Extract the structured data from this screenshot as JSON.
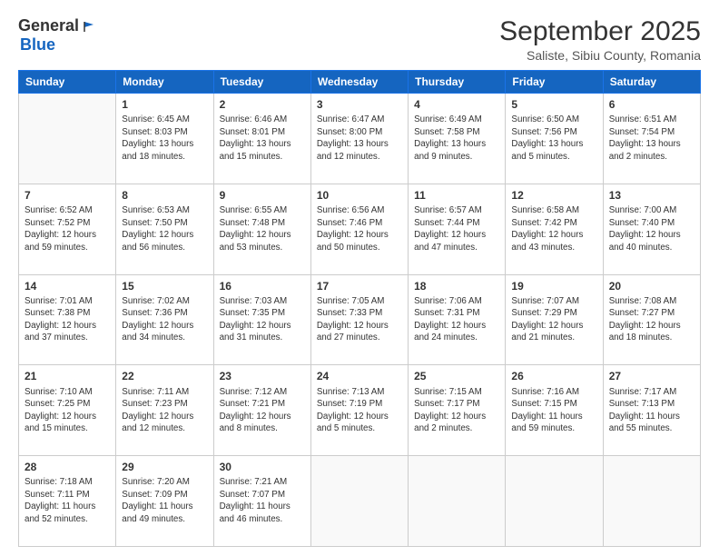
{
  "logo": {
    "general": "General",
    "blue": "Blue"
  },
  "title": "September 2025",
  "subtitle": "Saliste, Sibiu County, Romania",
  "header_days": [
    "Sunday",
    "Monday",
    "Tuesday",
    "Wednesday",
    "Thursday",
    "Friday",
    "Saturday"
  ],
  "weeks": [
    [
      {
        "day": "",
        "info": ""
      },
      {
        "day": "1",
        "info": "Sunrise: 6:45 AM\nSunset: 8:03 PM\nDaylight: 13 hours\nand 18 minutes."
      },
      {
        "day": "2",
        "info": "Sunrise: 6:46 AM\nSunset: 8:01 PM\nDaylight: 13 hours\nand 15 minutes."
      },
      {
        "day": "3",
        "info": "Sunrise: 6:47 AM\nSunset: 8:00 PM\nDaylight: 13 hours\nand 12 minutes."
      },
      {
        "day": "4",
        "info": "Sunrise: 6:49 AM\nSunset: 7:58 PM\nDaylight: 13 hours\nand 9 minutes."
      },
      {
        "day": "5",
        "info": "Sunrise: 6:50 AM\nSunset: 7:56 PM\nDaylight: 13 hours\nand 5 minutes."
      },
      {
        "day": "6",
        "info": "Sunrise: 6:51 AM\nSunset: 7:54 PM\nDaylight: 13 hours\nand 2 minutes."
      }
    ],
    [
      {
        "day": "7",
        "info": "Sunrise: 6:52 AM\nSunset: 7:52 PM\nDaylight: 12 hours\nand 59 minutes."
      },
      {
        "day": "8",
        "info": "Sunrise: 6:53 AM\nSunset: 7:50 PM\nDaylight: 12 hours\nand 56 minutes."
      },
      {
        "day": "9",
        "info": "Sunrise: 6:55 AM\nSunset: 7:48 PM\nDaylight: 12 hours\nand 53 minutes."
      },
      {
        "day": "10",
        "info": "Sunrise: 6:56 AM\nSunset: 7:46 PM\nDaylight: 12 hours\nand 50 minutes."
      },
      {
        "day": "11",
        "info": "Sunrise: 6:57 AM\nSunset: 7:44 PM\nDaylight: 12 hours\nand 47 minutes."
      },
      {
        "day": "12",
        "info": "Sunrise: 6:58 AM\nSunset: 7:42 PM\nDaylight: 12 hours\nand 43 minutes."
      },
      {
        "day": "13",
        "info": "Sunrise: 7:00 AM\nSunset: 7:40 PM\nDaylight: 12 hours\nand 40 minutes."
      }
    ],
    [
      {
        "day": "14",
        "info": "Sunrise: 7:01 AM\nSunset: 7:38 PM\nDaylight: 12 hours\nand 37 minutes."
      },
      {
        "day": "15",
        "info": "Sunrise: 7:02 AM\nSunset: 7:36 PM\nDaylight: 12 hours\nand 34 minutes."
      },
      {
        "day": "16",
        "info": "Sunrise: 7:03 AM\nSunset: 7:35 PM\nDaylight: 12 hours\nand 31 minutes."
      },
      {
        "day": "17",
        "info": "Sunrise: 7:05 AM\nSunset: 7:33 PM\nDaylight: 12 hours\nand 27 minutes."
      },
      {
        "day": "18",
        "info": "Sunrise: 7:06 AM\nSunset: 7:31 PM\nDaylight: 12 hours\nand 24 minutes."
      },
      {
        "day": "19",
        "info": "Sunrise: 7:07 AM\nSunset: 7:29 PM\nDaylight: 12 hours\nand 21 minutes."
      },
      {
        "day": "20",
        "info": "Sunrise: 7:08 AM\nSunset: 7:27 PM\nDaylight: 12 hours\nand 18 minutes."
      }
    ],
    [
      {
        "day": "21",
        "info": "Sunrise: 7:10 AM\nSunset: 7:25 PM\nDaylight: 12 hours\nand 15 minutes."
      },
      {
        "day": "22",
        "info": "Sunrise: 7:11 AM\nSunset: 7:23 PM\nDaylight: 12 hours\nand 12 minutes."
      },
      {
        "day": "23",
        "info": "Sunrise: 7:12 AM\nSunset: 7:21 PM\nDaylight: 12 hours\nand 8 minutes."
      },
      {
        "day": "24",
        "info": "Sunrise: 7:13 AM\nSunset: 7:19 PM\nDaylight: 12 hours\nand 5 minutes."
      },
      {
        "day": "25",
        "info": "Sunrise: 7:15 AM\nSunset: 7:17 PM\nDaylight: 12 hours\nand 2 minutes."
      },
      {
        "day": "26",
        "info": "Sunrise: 7:16 AM\nSunset: 7:15 PM\nDaylight: 11 hours\nand 59 minutes."
      },
      {
        "day": "27",
        "info": "Sunrise: 7:17 AM\nSunset: 7:13 PM\nDaylight: 11 hours\nand 55 minutes."
      }
    ],
    [
      {
        "day": "28",
        "info": "Sunrise: 7:18 AM\nSunset: 7:11 PM\nDaylight: 11 hours\nand 52 minutes."
      },
      {
        "day": "29",
        "info": "Sunrise: 7:20 AM\nSunset: 7:09 PM\nDaylight: 11 hours\nand 49 minutes."
      },
      {
        "day": "30",
        "info": "Sunrise: 7:21 AM\nSunset: 7:07 PM\nDaylight: 11 hours\nand 46 minutes."
      },
      {
        "day": "",
        "info": ""
      },
      {
        "day": "",
        "info": ""
      },
      {
        "day": "",
        "info": ""
      },
      {
        "day": "",
        "info": ""
      }
    ]
  ]
}
